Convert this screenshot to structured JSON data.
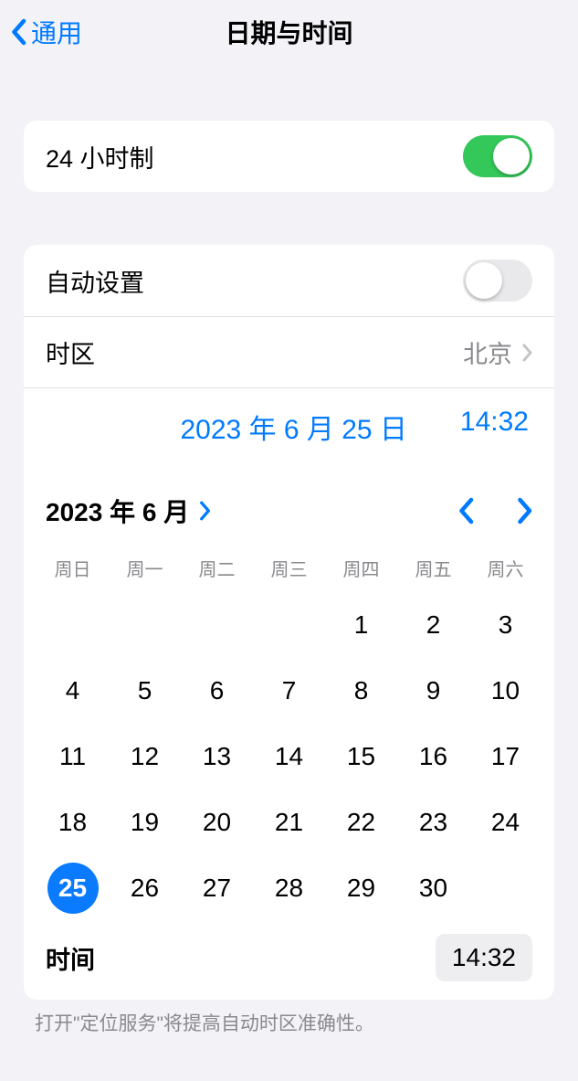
{
  "nav": {
    "back_label": "通用",
    "title": "日期与时间"
  },
  "toggle24h": {
    "label": "24 小时制",
    "on": true
  },
  "auto_set": {
    "label": "自动设置",
    "on": false
  },
  "timezone": {
    "label": "时区",
    "value": "北京"
  },
  "selected": {
    "date_display": "2023 年 6 月 25 日",
    "time_display": "14:32"
  },
  "calendar": {
    "title": "2023 年 6 月",
    "weekdays": [
      "周日",
      "周一",
      "周二",
      "周三",
      "周四",
      "周五",
      "周六"
    ],
    "weeks": [
      [
        "",
        "",
        "",
        "",
        "1",
        "2",
        "3"
      ],
      [
        "4",
        "5",
        "6",
        "7",
        "8",
        "9",
        "10"
      ],
      [
        "11",
        "12",
        "13",
        "14",
        "15",
        "16",
        "17"
      ],
      [
        "18",
        "19",
        "20",
        "21",
        "22",
        "23",
        "24"
      ],
      [
        "25",
        "26",
        "27",
        "28",
        "29",
        "30",
        ""
      ]
    ],
    "selected_day": "25"
  },
  "time_row": {
    "label": "时间",
    "value": "14:32"
  },
  "footer_note": "打开\"定位服务\"将提高自动时区准确性。"
}
